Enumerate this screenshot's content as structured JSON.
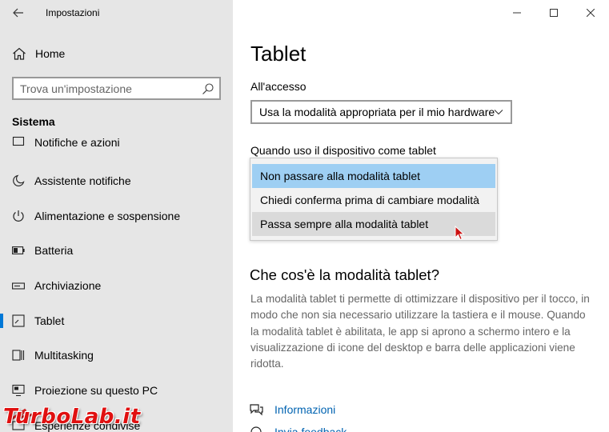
{
  "window": {
    "app_title": "Impostazioni",
    "controls": {
      "minimize": "—",
      "maximize": "☐",
      "close": "✕"
    }
  },
  "sidebar": {
    "home_label": "Home",
    "search_placeholder": "Trova un'impostazione",
    "section_title": "Sistema",
    "items": [
      {
        "label": "Notifiche e azioni",
        "icon": "notifications-icon",
        "active": false
      },
      {
        "label": "Assistente notifiche",
        "icon": "moon-icon",
        "active": false
      },
      {
        "label": "Alimentazione e sospensione",
        "icon": "power-icon",
        "active": false
      },
      {
        "label": "Batteria",
        "icon": "battery-icon",
        "active": false
      },
      {
        "label": "Archiviazione",
        "icon": "storage-icon",
        "active": false
      },
      {
        "label": "Tablet",
        "icon": "tablet-icon",
        "active": true
      },
      {
        "label": "Multitasking",
        "icon": "multitasking-icon",
        "active": false
      },
      {
        "label": "Proiezione su questo PC",
        "icon": "projection-icon",
        "active": false
      },
      {
        "label": "Esperienze condivise",
        "icon": "shared-experiences-icon",
        "active": false
      }
    ]
  },
  "main": {
    "title": "Tablet",
    "access_label": "All'accesso",
    "access_value": "Usa la modalità appropriata per il mio hardware",
    "tablet_use_label": "Quando uso il dispositivo come tablet",
    "tablet_options": [
      "Non passare alla modalità tablet",
      "Chiedi conferma prima di cambiare modalità",
      "Passa sempre alla modalità tablet"
    ],
    "section_title": "Che cos'è la modalità tablet?",
    "description": "La modalità tablet ti permette di ottimizzare il dispositivo per il tocco, in modo che non sia necessario utilizzare la tastiera e il mouse. Quando la modalità tablet è abilitata, le app si aprono a schermo intero e la visualizzazione di icone del desktop e barra delle applicazioni viene ridotta.",
    "links": [
      {
        "label": "Informazioni",
        "icon": "help-chat-icon"
      },
      {
        "label": "Invia feedback",
        "icon": "feedback-icon"
      }
    ]
  },
  "watermark": "TurboLab.it",
  "colors": {
    "sidebar_bg": "#e6e6e6",
    "accent": "#0078d7",
    "selected_option": "#9ecff3",
    "hover_option": "#dadada",
    "link": "#0063b1"
  }
}
